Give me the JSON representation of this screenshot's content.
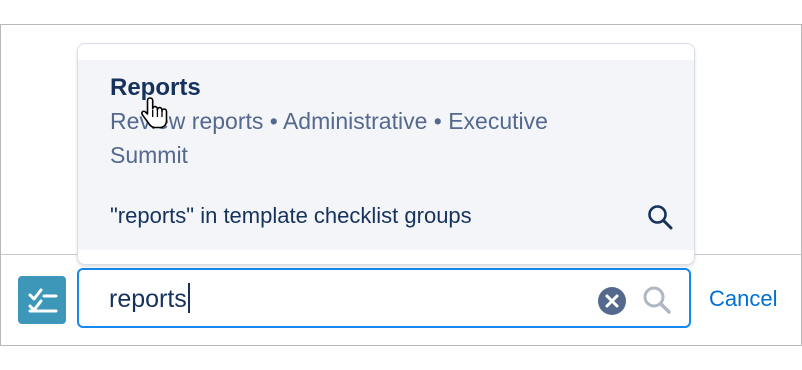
{
  "dropdown": {
    "result": {
      "title": "Reports",
      "subtitle": "Review reports • Administrative • Executive Summit"
    },
    "scope_search": {
      "text": "\"reports\" in template checklist groups",
      "icon": "search-icon"
    }
  },
  "search": {
    "value": "reports",
    "clear_icon": "clear-icon",
    "search_icon": "search-icon"
  },
  "checklist_button": {
    "icon": "checklist-icon"
  },
  "cancel_label": "Cancel",
  "colors": {
    "accent_blue": "#1589ee",
    "link_blue": "#0070d2",
    "checklist_teal": "#3c97b9",
    "title_navy": "#16325c",
    "subtitle_slate": "#54698d",
    "dropdown_bg": "#f3f5f9"
  }
}
